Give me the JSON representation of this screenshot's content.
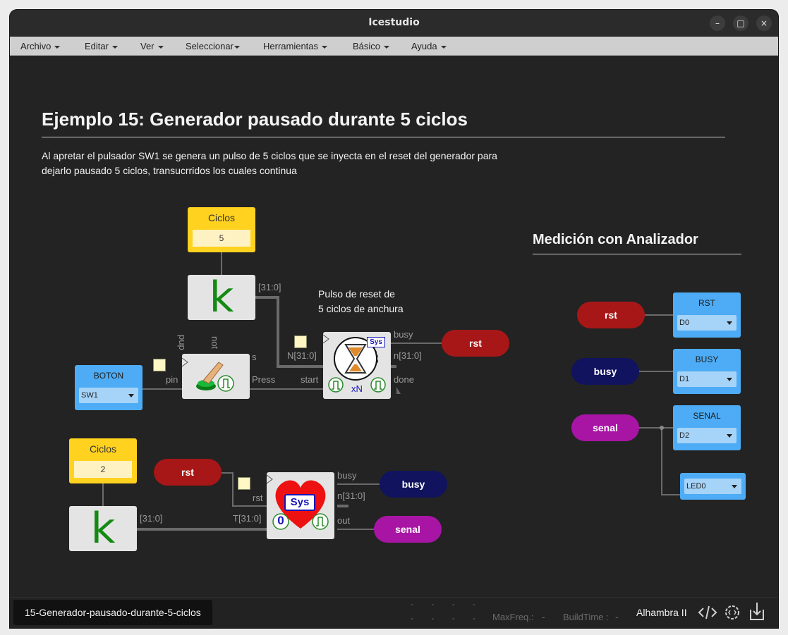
{
  "window": {
    "title": "Icestudio",
    "controls": {
      "minimize": "–",
      "maximize": "□",
      "close": "×"
    }
  },
  "menu": [
    "Archivo",
    "Editar",
    "Ver",
    "Seleccionar",
    "Herramientas",
    "Básico",
    "Ayuda"
  ],
  "doc": {
    "title": "Ejemplo 15: Generador pausado durante 5 ciclos",
    "description_line1": "Al apretar el pulsador SW1 se genera un pulso de 5 ciclos que se inyecta en el reset del generador para",
    "description_line2": "dejarlo pausado 5 ciclos, transucrridos los cuales continua",
    "annotation_line1": "Pulso de reset de",
    "annotation_line2": "5 ciclos de anchura",
    "side_heading": "Medición con Analizador"
  },
  "constants": [
    {
      "title": "Ciclos",
      "value": "5"
    },
    {
      "title": "Ciclos",
      "value": "2"
    }
  ],
  "k_letter": "k",
  "blocks": {
    "boton_input": {
      "title": "BOTON",
      "value": "SW1"
    },
    "button_block": {
      "ports_top": [
        "pup",
        "not"
      ],
      "in": "pin",
      "outs": [
        "s",
        "Press"
      ]
    },
    "timer_block": {
      "in": "N[31:0]",
      "start": "start",
      "outs": [
        "busy",
        "n[31:0]",
        "done"
      ],
      "badge": "Sys",
      "caption": "xN"
    },
    "heart_block": {
      "ins": [
        "rst",
        "T[31:0]"
      ],
      "outs": [
        "busy",
        "n[31:0]",
        "out"
      ],
      "badge": "Sys",
      "zero": "0"
    },
    "bus_label": "[31:0]"
  },
  "signals": {
    "rst": "rst",
    "busy": "busy",
    "senal": "senal"
  },
  "analyzer": [
    {
      "title": "RST",
      "value": "D0"
    },
    {
      "title": "BUSY",
      "value": "D1"
    },
    {
      "title": "SENAL",
      "value": "D2"
    },
    {
      "title": "",
      "value": "LED0"
    }
  ],
  "status": {
    "file": "15-Generador-pausado-durante-5-ciclos",
    "dashes": "-",
    "maxfreq_label": "MaxFreq.:",
    "maxfreq_value": "-",
    "buildtime_label": "BuildTime :",
    "buildtime_value": "-",
    "board": "Alhambra II",
    "icons": [
      "code-icon",
      "settings-icon",
      "download-icon"
    ]
  },
  "colors": {
    "yellow": "#ffd21f",
    "blue": "#4dacf5",
    "red": "#a81717",
    "navy": "#11135f",
    "purple": "#a815a5",
    "green": "#148a12"
  }
}
